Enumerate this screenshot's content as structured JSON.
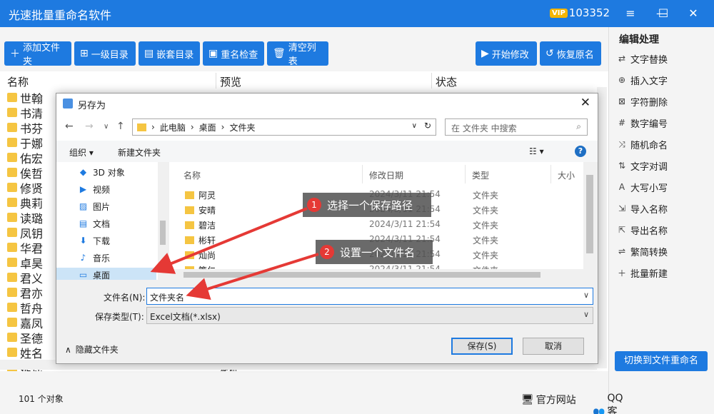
{
  "app": {
    "title": "光速批量重命名软件",
    "vip_label": "VIP",
    "user_id": "103352",
    "window_controls": {
      "menu": "≡",
      "minimize": "—",
      "maximize": "☐",
      "close": "✕"
    }
  },
  "toolbar": {
    "add_files": "添加文件夹",
    "level1_dir": "一级目录",
    "nested_dir": "嵌套目录",
    "dup_check": "重名检查",
    "clear_list": "清空列表",
    "start_modify": "开始修改",
    "restore_name": "恢复原名"
  },
  "right_panel": {
    "title": "编辑处理",
    "items": [
      {
        "label": "文字替换",
        "icon": "⇄"
      },
      {
        "label": "插入文字",
        "icon": "⊕"
      },
      {
        "label": "字符删除",
        "icon": "⊠"
      },
      {
        "label": "数字编号",
        "icon": "#"
      },
      {
        "label": "随机命名",
        "icon": "⤨"
      },
      {
        "label": "文字对调",
        "icon": "⇅"
      },
      {
        "label": "大写小写",
        "icon": "A"
      },
      {
        "label": "导入名称",
        "icon": "⇲"
      },
      {
        "label": "导出名称",
        "icon": "⇱"
      },
      {
        "label": "繁简转换",
        "icon": "⇌"
      },
      {
        "label": "批量新建",
        "icon": "＋"
      }
    ],
    "switch_button": "切换到文件重命名"
  },
  "list": {
    "headers": {
      "name": "名称",
      "preview": "预览",
      "status": "状态"
    },
    "rows": [
      "世翰",
      "书清",
      "书芬",
      "于娜",
      "佑宏",
      "俟哲",
      "修贤",
      "典莉",
      "读璐",
      "凤钥",
      "华君",
      "卓昊",
      "君义",
      "君亦",
      "哲舟",
      "嘉凤",
      "圣德",
      "姓名",
      "婕谣"
    ],
    "preview_last": "婕谣"
  },
  "status": {
    "count": "101 个对象",
    "official_site": "官方网站",
    "qq_service": "QQ客服"
  },
  "dialog": {
    "title": "另存为",
    "path": [
      "此电脑",
      "桌面",
      "文件夹"
    ],
    "search_placeholder": "在 文件夹 中搜索",
    "organize": "组织 ▾",
    "new_folder": "新建文件夹",
    "tree": [
      {
        "label": "3D 对象",
        "icon": "cube"
      },
      {
        "label": "视频",
        "icon": "video"
      },
      {
        "label": "图片",
        "icon": "picture"
      },
      {
        "label": "文档",
        "icon": "document"
      },
      {
        "label": "下载",
        "icon": "download"
      },
      {
        "label": "音乐",
        "icon": "music"
      },
      {
        "label": "桌面",
        "icon": "desktop"
      }
    ],
    "columns": {
      "name": "名称",
      "date": "修改日期",
      "type": "类型",
      "size": "大小"
    },
    "files": [
      {
        "name": "阿灵",
        "date": "2024/3/11 21:54",
        "type": "文件夹"
      },
      {
        "name": "安晴",
        "date": "2024/3/11 21:54",
        "type": "文件夹"
      },
      {
        "name": "碧洁",
        "date": "2024/3/11 21:54",
        "type": "文件夹"
      },
      {
        "name": "彬轩",
        "date": "2024/3/11 21:54",
        "type": "文件夹"
      },
      {
        "name": "灿尚",
        "date": "2024/3/11 21:54",
        "type": "文件夹"
      },
      {
        "name": "策仁",
        "date": "2024/3/11 21:54",
        "type": "文件夹"
      }
    ],
    "filename_label": "文件名(N):",
    "filename_value": "文件夹名",
    "filetype_label": "保存类型(T):",
    "filetype_value": "Excel文档(*.xlsx)",
    "hide_folders": "隐藏文件夹",
    "save": "保存(S)",
    "cancel": "取消"
  },
  "callouts": [
    {
      "num": "1",
      "text": "选择一个保存路径"
    },
    {
      "num": "2",
      "text": "设置一个文件名"
    }
  ],
  "colors": {
    "accent": "#1e7ae0",
    "arrow": "#e53935"
  }
}
